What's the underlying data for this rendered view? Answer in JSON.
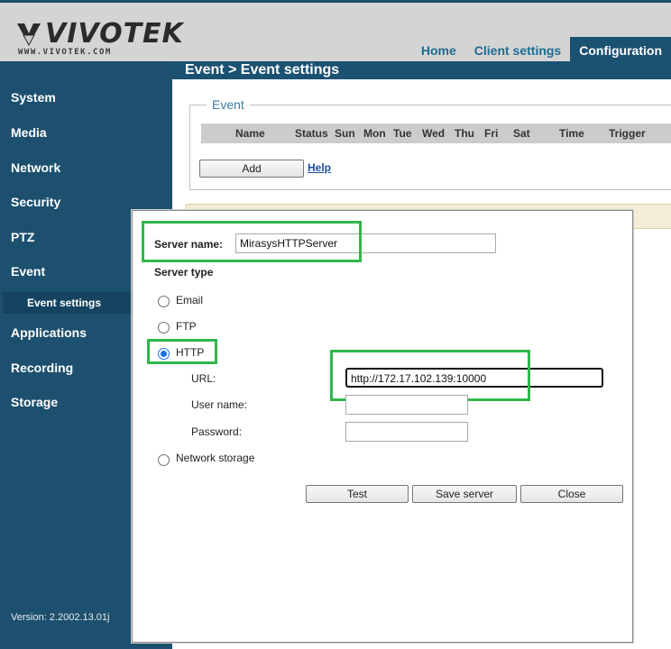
{
  "header": {
    "logo_text": "VIVOTEK",
    "logo_web": "WWW.VIVOTEK.COM",
    "tabs": [
      "Home",
      "Client settings",
      "Configuration"
    ]
  },
  "sidebar": {
    "items": [
      "System",
      "Media",
      "Network",
      "Security",
      "PTZ",
      "Event"
    ],
    "sub_item": "Event settings",
    "items_after": [
      "Applications",
      "Recording",
      "Storage"
    ],
    "version": "Version: 2.2002.13.01j"
  },
  "main": {
    "breadcrumb": "Event  > Event settings",
    "event_legend": "Event",
    "columns": [
      "Name",
      "Status",
      "Sun",
      "Mon",
      "Tue",
      "Wed",
      "Thu",
      "Fri",
      "Sat",
      "Time",
      "Trigger"
    ],
    "add_label": "Add",
    "help_label": "Help"
  },
  "dialog": {
    "server_name_label": "Server name:",
    "server_name_value": "MirasysHTTPServer",
    "server_type_label": "Server type",
    "types": [
      "Email",
      "FTP",
      "HTTP",
      "Network storage"
    ],
    "selected_type": "HTTP",
    "url_label": "URL:",
    "url_value": "http://172.17.102.139:10000",
    "username_label": "User name:",
    "username_value": "",
    "password_label": "Password:",
    "password_value": "",
    "buttons": [
      "Test",
      "Save server",
      "Close"
    ]
  },
  "colors": {
    "sidebar": "#1d506e",
    "accent_tab": "#1b5272",
    "highlight": "#2fb84a",
    "radio_checked": "#1a73e8"
  }
}
